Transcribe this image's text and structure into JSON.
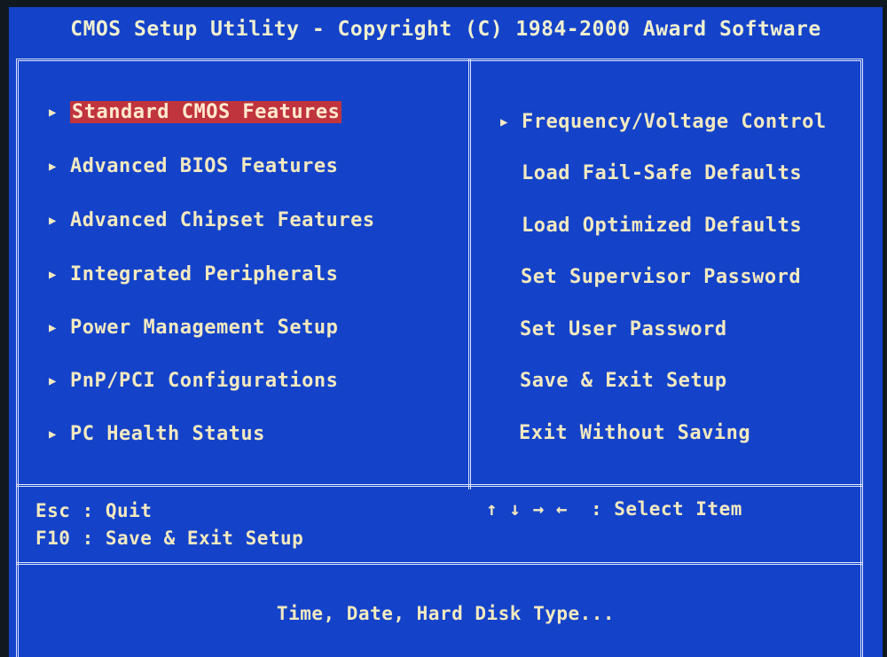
{
  "title": "CMOS Setup Utility - Copyright (C) 1984-2000 Award Software",
  "left_menu": [
    {
      "label": "Standard CMOS Features",
      "selected": true
    },
    {
      "label": "Advanced BIOS Features"
    },
    {
      "label": "Advanced Chipset Features"
    },
    {
      "label": "Integrated Peripherals"
    },
    {
      "label": "Power Management Setup"
    },
    {
      "label": "PnP/PCI Configurations"
    },
    {
      "label": "PC Health Status"
    }
  ],
  "right_menu": [
    {
      "label": "Frequency/Voltage Control"
    },
    {
      "label": "Load Fail-Safe Defaults"
    },
    {
      "label": "Load Optimized Defaults"
    },
    {
      "label": "Set Supervisor Password"
    },
    {
      "label": "Set User Password"
    },
    {
      "label": "Save & Exit Setup"
    },
    {
      "label": "Exit Without Saving"
    }
  ],
  "help": {
    "esc": "Esc : Quit",
    "f10": "F10 : Save & Exit Setup",
    "arrows": "↑ ↓ → ←",
    "select": ": Select Item"
  },
  "description": "Time, Date, Hard Disk Type...",
  "colors": {
    "background": "#1443c9",
    "text": "#f3e9c0",
    "highlight": "#c0343d"
  }
}
